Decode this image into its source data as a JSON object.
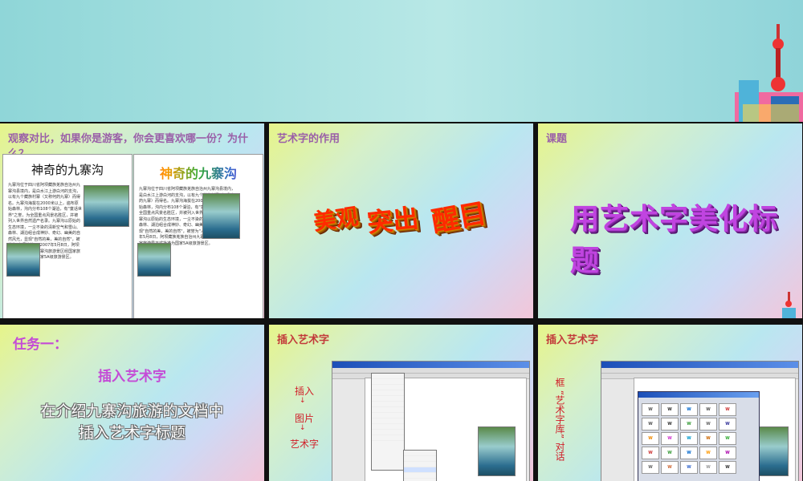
{
  "slide1": {
    "title": "观察对比，如果你是游客，你会更喜欢哪一份？为什么？",
    "doc_left_title": "神奇的九寨沟",
    "doc_right_title": "神奇的九寨沟",
    "body": "九寨沟位于四川省阿坝藏族羌族自治州九寨沟县境内，是白水江上游白河的支沟，以有九个藏族村寨（又称何药九寨）而得名。九寨沟海拔在2000米以上，遍布原始森林，沟内分布108个湖泊，有\"童话世界\"之誉，为全国重点风景名胜区，并被列入世界自然遗产名录。九寨沟以原始的生态环境，一尘不染的清新空气和雪山、森林、湖泊组合成神妙、奇幻、幽美的自然风光，显现\"自然的美，美的自然\"，被誉为\"人间仙境\"。2007年5月8日，阿坝藏族羌族自治州九寨沟旅游景区经国家旅游局正式批准为国家5A级旅游景区。"
  },
  "slide2": {
    "title": "艺术字的作用",
    "words": [
      "美观",
      "突出",
      "醒目"
    ]
  },
  "slide3": {
    "title": "课题",
    "headline": "用艺术字美化标题"
  },
  "slide4": {
    "title": "任务一：",
    "subtitle": "插入艺术字",
    "line1": "在介绍九寨沟旅游的文档中",
    "line2": "插入艺术字标题"
  },
  "slide5": {
    "title": "插入艺术字",
    "steps": [
      "插入",
      "图片",
      "艺术字"
    ]
  },
  "slide6": {
    "title": "插入艺术字",
    "side_label": "框 “艺术字库” 对话"
  }
}
